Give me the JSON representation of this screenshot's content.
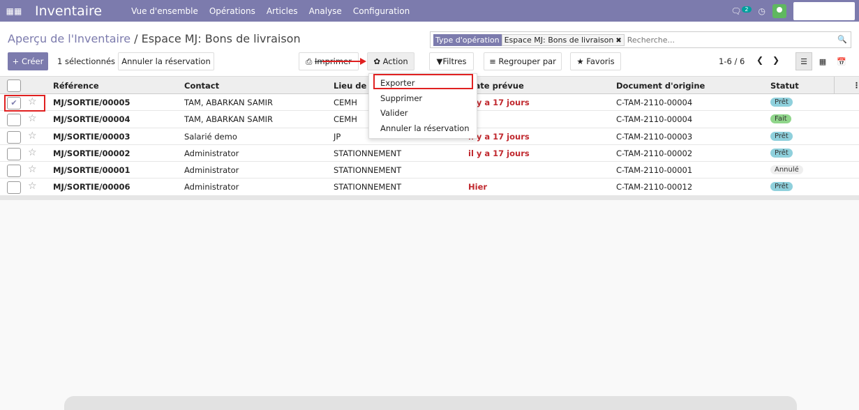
{
  "topbar": {
    "apps_icon": "grid-icon",
    "app_title": "Inventaire",
    "menu": [
      "Vue d'ensemble",
      "Opérations",
      "Articles",
      "Analyse",
      "Configuration"
    ],
    "chat_count": "2"
  },
  "breadcrumb": {
    "parent": "Aperçu de l'Inventaire",
    "separator": "/",
    "current": "Espace MJ: Bons de livraison"
  },
  "search": {
    "facet_label": "Type d'opération",
    "facet_value": "Espace MJ: Bons de livraison",
    "placeholder": "Recherche..."
  },
  "toolbar": {
    "create_label": "+ Créer",
    "selected_text": "1 sélectionnés",
    "cancel_reservation_label": "Annuler la réservation",
    "print_label": "Imprimer",
    "action_label": "✿ Action",
    "filters_label": "Filtres",
    "group_by_label": "Regrouper par",
    "favorites_label": "Favoris",
    "pager": "1-6 / 6"
  },
  "table": {
    "headers": [
      "Référence",
      "Contact",
      "Lieu de",
      "Date prévue",
      "Document d'origine",
      "Statut"
    ],
    "rows": [
      {
        "ref": "MJ/SORTIE/00005",
        "contact": "TAM, ABARKAN SAMIR",
        "location": "CEMH",
        "date": "il y a 17 jours",
        "origin": "C-TAM-2110-00004",
        "status": "Prêt",
        "status_kind": "ready",
        "checked": true
      },
      {
        "ref": "MJ/SORTIE/00004",
        "contact": "TAM, ABARKAN SAMIR",
        "location": "CEMH",
        "date": "",
        "origin": "C-TAM-2110-00004",
        "status": "Fait",
        "status_kind": "done",
        "checked": false
      },
      {
        "ref": "MJ/SORTIE/00003",
        "contact": "Salarié demo",
        "location": "JP",
        "date": "il y a 17 jours",
        "origin": "C-TAM-2110-00003",
        "status": "Prêt",
        "status_kind": "ready",
        "checked": false
      },
      {
        "ref": "MJ/SORTIE/00002",
        "contact": "Administrator",
        "location": "STATIONNEMENT",
        "date": "il y a 17 jours",
        "origin": "C-TAM-2110-00002",
        "status": "Prêt",
        "status_kind": "ready",
        "checked": false
      },
      {
        "ref": "MJ/SORTIE/00001",
        "contact": "Administrator",
        "location": "STATIONNEMENT",
        "date": "",
        "origin": "C-TAM-2110-00001",
        "status": "Annulé",
        "status_kind": "cancel",
        "checked": false
      },
      {
        "ref": "MJ/SORTIE/00006",
        "contact": "Administrator",
        "location": "STATIONNEMENT",
        "date": "Hier",
        "origin": "C-TAM-2110-00012",
        "status": "Prêt",
        "status_kind": "ready",
        "checked": false
      }
    ]
  },
  "action_menu": {
    "items": [
      "Exporter",
      "Supprimer",
      "Valider",
      "Annuler la réservation"
    ]
  },
  "colors": {
    "brand": "#7c7bad",
    "late": "#c0282e",
    "highlight": "#e02020"
  }
}
